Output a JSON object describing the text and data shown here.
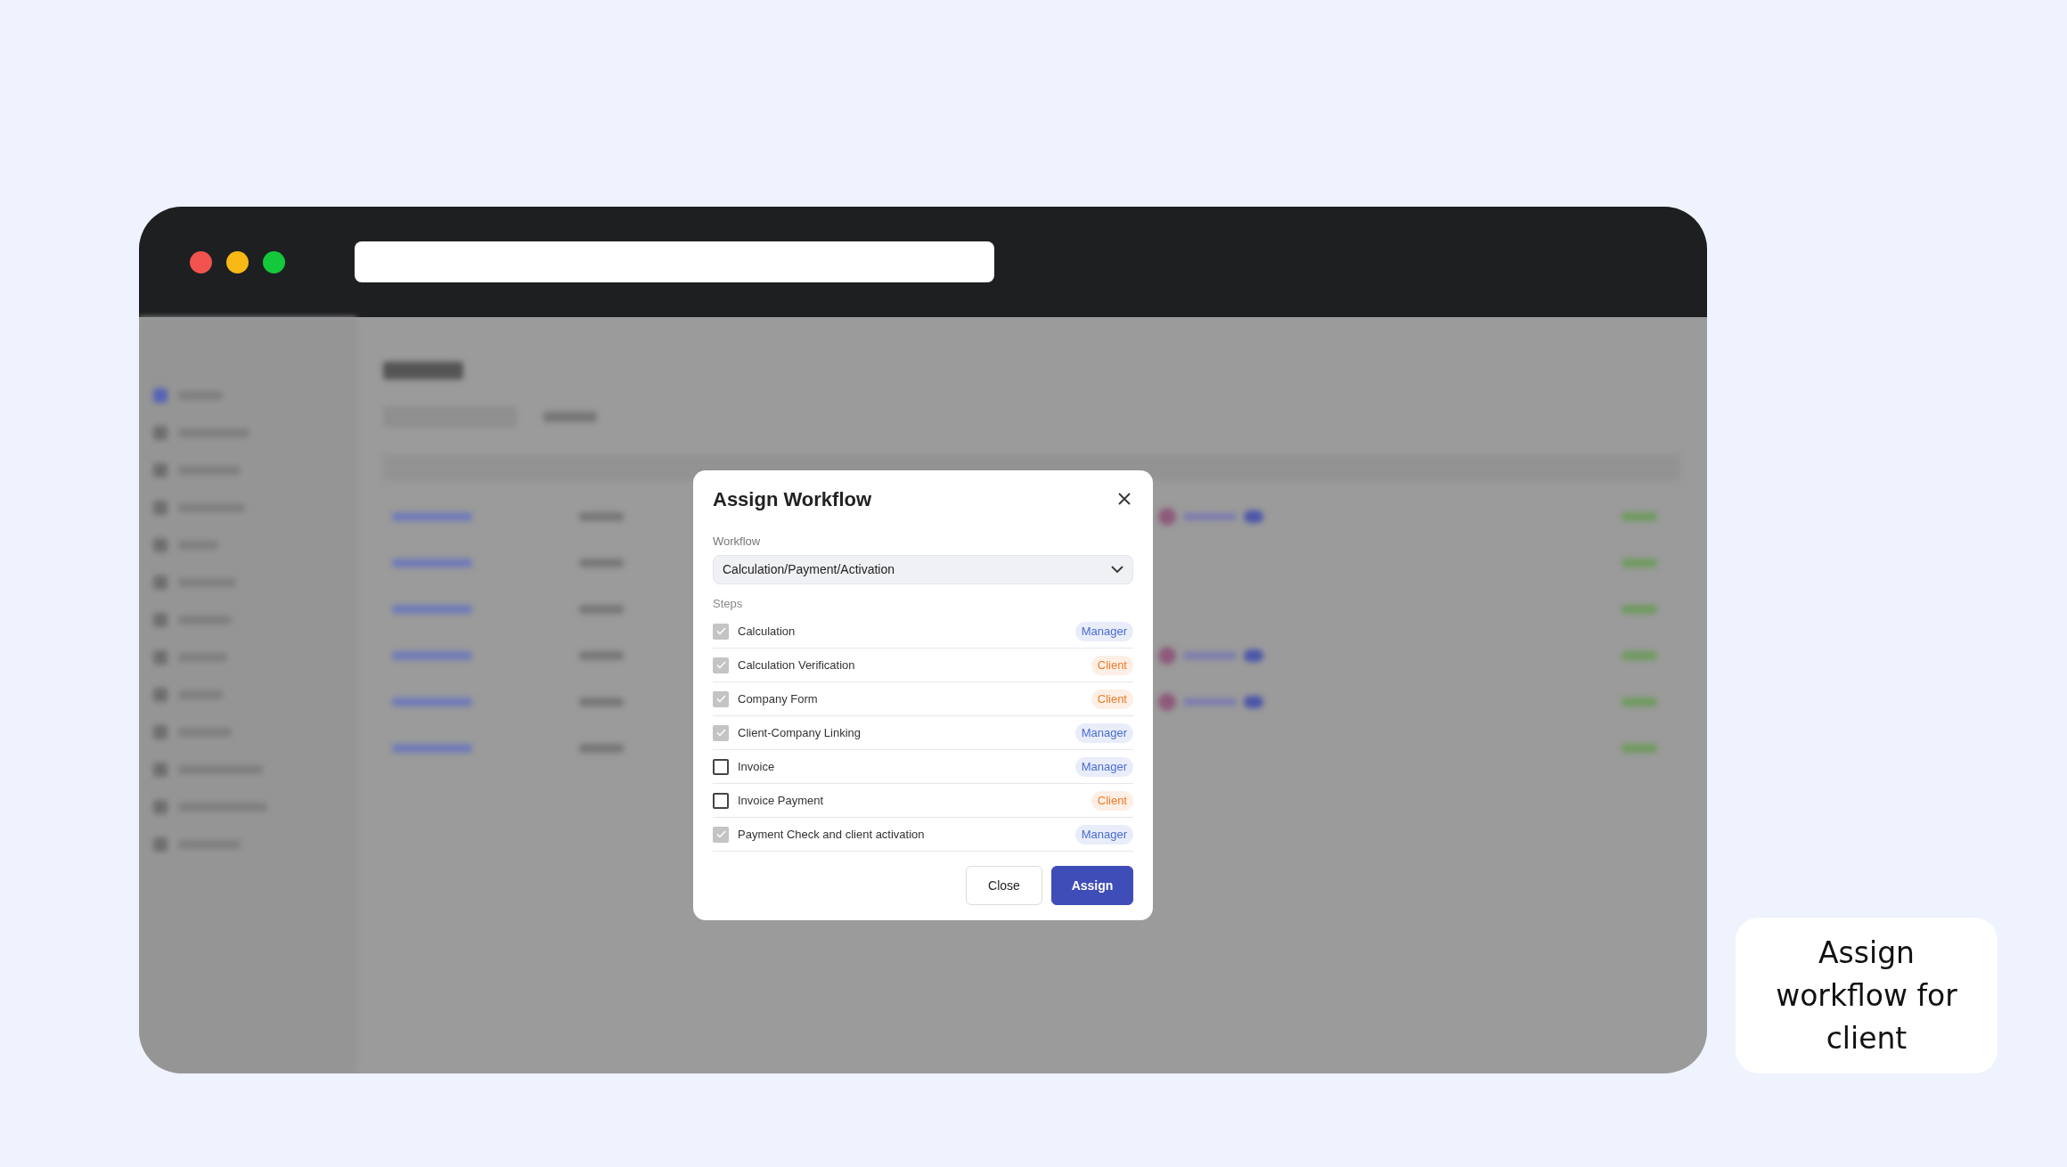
{
  "dialog": {
    "title": "Assign Workflow",
    "workflow": {
      "label": "Workflow",
      "value": "Calculation/Payment/Activation"
    },
    "steps_label": "Steps",
    "steps": [
      {
        "label": "Calculation",
        "checked": true,
        "role": {
          "text": "Manager",
          "color": "#4a6cd4"
        }
      },
      {
        "label": "Calculation Verification",
        "checked": true,
        "role": {
          "text": "Client",
          "color": "#ef7a2a"
        }
      },
      {
        "label": "Company Form",
        "checked": true,
        "role": {
          "text": "Client",
          "color": "#ef7a2a"
        }
      },
      {
        "label": "Client-Company Linking",
        "checked": true,
        "role": {
          "text": "Manager",
          "color": "#4a6cd4"
        }
      },
      {
        "label": "Invoice",
        "checked": false,
        "role": {
          "text": "Manager",
          "color": "#4a6cd4"
        }
      },
      {
        "label": "Invoice Payment",
        "checked": false,
        "role": {
          "text": "Client",
          "color": "#ef7a2a"
        }
      },
      {
        "label": "Payment Check and client activation",
        "checked": true,
        "role": {
          "text": "Manager",
          "color": "#4a6cd4"
        }
      }
    ],
    "buttons": [
      {
        "label": "Close",
        "kind": "secondary"
      },
      {
        "label": "Assign",
        "kind": "primary"
      }
    ]
  },
  "caption": "Assign workflow for client"
}
